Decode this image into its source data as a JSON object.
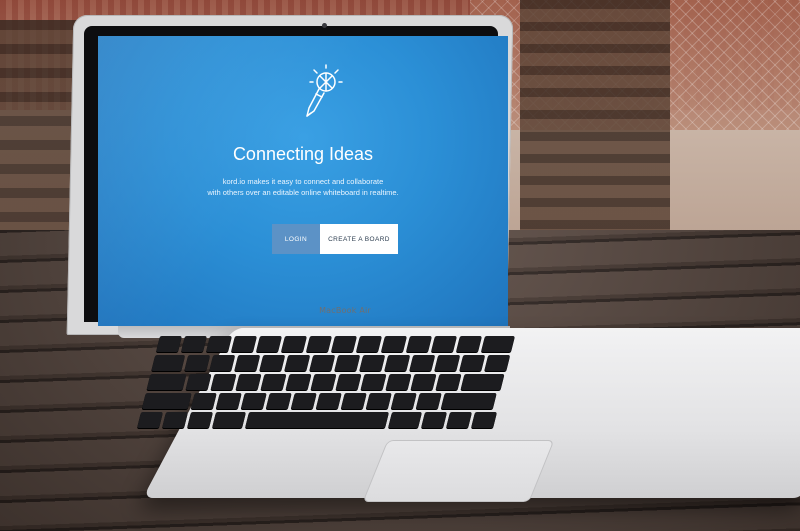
{
  "device": {
    "brand_label": "MacBook Air"
  },
  "screen": {
    "logo": "lightbulb-pencil-icon",
    "title": "Connecting Ideas",
    "subtitle_line1": "kord.io makes it easy to connect and collaborate",
    "subtitle_line2": "with others over an editable online whiteboard in realtime.",
    "buttons": {
      "login": "LOGIN",
      "create_board": "CREATE A BOARD"
    },
    "colors": {
      "background": "#2b8fd6",
      "login_button": "#5c92c6",
      "create_button": "#ffffff"
    }
  }
}
